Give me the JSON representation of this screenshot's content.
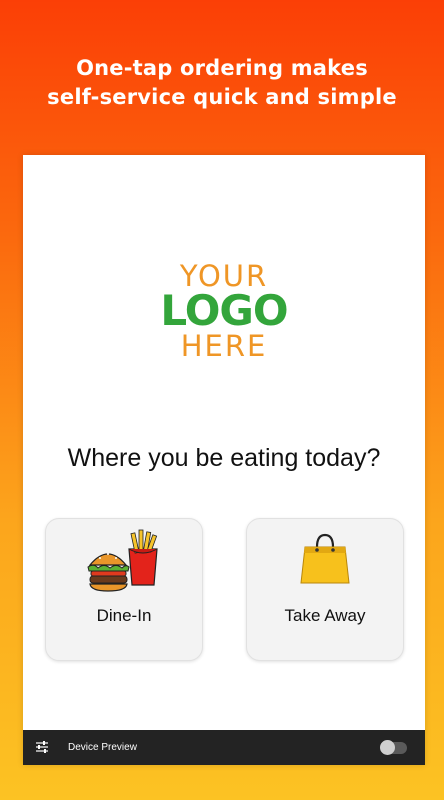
{
  "headline": {
    "line1": "One-tap ordering makes",
    "line2": "self-service quick and simple"
  },
  "logo": {
    "line1": "YOUR",
    "line2": "LOGO",
    "line3": "HERE"
  },
  "question": "Where you be eating today?",
  "options": [
    {
      "label": "Dine-In",
      "icon": "burger-fries-icon"
    },
    {
      "label": "Take Away",
      "icon": "shopping-bag-icon"
    }
  ],
  "bottom_bar": {
    "label": "Device Preview",
    "toggle_on": false
  },
  "colors": {
    "gradient_top": "#fb3f06",
    "gradient_bottom": "#fcc323",
    "logo_orange": "#ef9626",
    "logo_green": "#33a53b",
    "bottom_bar": "#232323"
  }
}
